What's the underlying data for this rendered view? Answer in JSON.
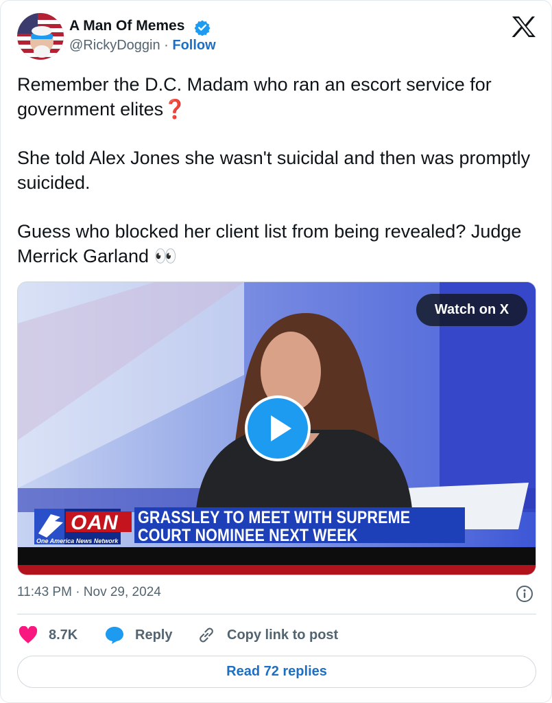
{
  "author": {
    "display_name": "A Man Of Memes",
    "handle": "@RickyDoggin",
    "separator": "·",
    "follow_label": "Follow"
  },
  "tweet": {
    "paragraphs": [
      "Remember the D.C. Madam who ran an escort service for government elites❓",
      "She told Alex Jones she wasn't suicidal and then was promptly suicided.",
      "Guess who blocked her client list from being revealed? Judge Merrick Garland 👀"
    ]
  },
  "media": {
    "watch_label": "Watch on X",
    "chyron": {
      "logo": "OAN",
      "network": "One America News Network",
      "line1": "GRASSLEY TO MEET WITH SUPREME",
      "line2": "COURT NOMINEE NEXT WEEK"
    }
  },
  "meta": {
    "timestamp": "11:43 PM · Nov 29, 2024"
  },
  "actions": {
    "like_count": "8.7K",
    "reply_label": "Reply",
    "copy_label": "Copy link to post"
  },
  "read_replies_label": "Read 72 replies",
  "colors": {
    "accent": "#1d9bf0",
    "link": "#1d6fc4",
    "like": "#f91880",
    "muted": "#536471"
  },
  "icons": [
    "verified-badge-icon",
    "x-logo-icon",
    "play-icon",
    "info-icon",
    "heart-icon",
    "reply-bubble-icon",
    "link-icon"
  ]
}
